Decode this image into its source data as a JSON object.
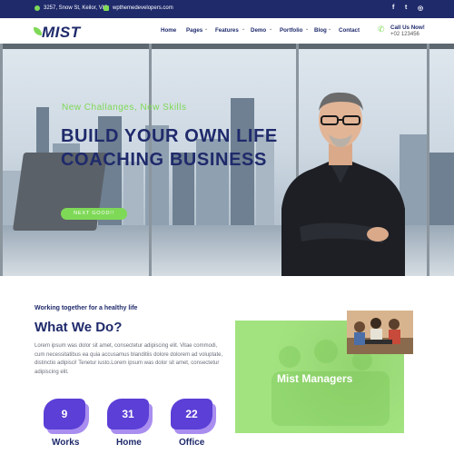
{
  "topbar": {
    "address": "3257, Snow St, Keilor, VIC",
    "email": "wpthemedevelopers.com",
    "social": [
      {
        "icon": "facebook-icon",
        "glyph": "f"
      },
      {
        "icon": "twitter-icon",
        "glyph": "t"
      },
      {
        "icon": "instagram-icon",
        "glyph": "◎"
      }
    ]
  },
  "nav": {
    "logo": "MIST",
    "items": [
      "Home",
      "Pages",
      "Features",
      "Demo",
      "Portfolio",
      "Blog",
      "Contact"
    ],
    "call_title": "Call Us Now!",
    "call_number": "+02 123456"
  },
  "hero": {
    "subtitle": "New Challanges, New Skills",
    "title": "BUILD YOUR OWN LIFE COACHING BUSINESS",
    "button": "NEXT GOOD!!"
  },
  "about": {
    "kicker": "Working together for a healthy life",
    "heading": "What We Do?",
    "paragraph": "Lorem ipsum was dolor sit amet, consectetur adipiscing elit. Vitae commodi, cum necessitatibus ea quia accusamus blanditiis dolore dolorem ad voluptate, distinctio adipisci! Tenetur iusto.Lorem ipsum was dolor sit amet, consectetur adipiscing elit.",
    "stats": [
      {
        "value": "9",
        "label": "Works"
      },
      {
        "value": "31",
        "label": "Home"
      },
      {
        "value": "22",
        "label": "Office"
      }
    ]
  },
  "card": {
    "title": "Mist Managers"
  },
  "colors": {
    "navy": "#1f2a6b",
    "green": "#7ed957",
    "purple": "#5b3fd6"
  }
}
